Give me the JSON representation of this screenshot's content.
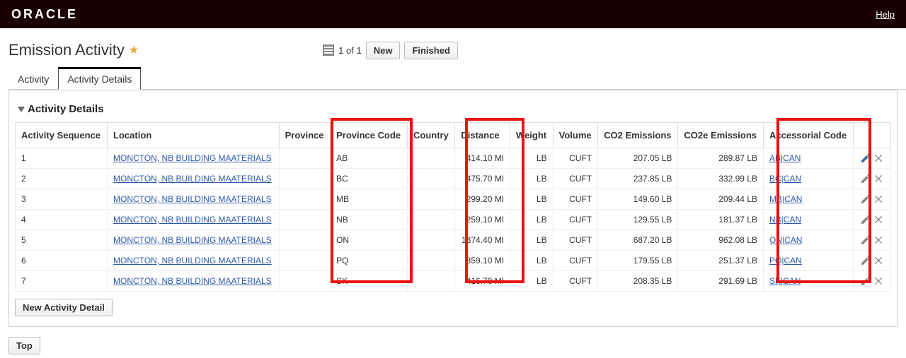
{
  "topbar": {
    "brand": "ORACLE",
    "help": "Help"
  },
  "header": {
    "title": "Emission Activity",
    "counter": "1 of 1",
    "btn_new": "New",
    "btn_finished": "Finished"
  },
  "tabs": {
    "activity": "Activity",
    "activity_details": "Activity Details"
  },
  "section": {
    "title": "Activity Details"
  },
  "columns": {
    "seq": "Activity Sequence",
    "location": "Location",
    "province": "Province",
    "province_code": "Province Code",
    "country": "Country",
    "distance": "Distance",
    "weight": "Weight",
    "volume": "Volume",
    "co2": "CO2 Emissions",
    "co2e": "CO2e Emissions",
    "acc_code": "Accessorial Code"
  },
  "rows": [
    {
      "seq": "1",
      "location": "MONCTON, NB BUILDING MAATERIALS",
      "province": "",
      "province_code": "AB",
      "country": "",
      "distance": "414.10 MI",
      "weight": "LB",
      "volume": "CUFT",
      "co2": "207.05 LB",
      "co2e": "289.87 LB",
      "acc": "AB|CAN"
    },
    {
      "seq": "2",
      "location": "MONCTON, NB BUILDING MAATERIALS",
      "province": "",
      "province_code": "BC",
      "country": "",
      "distance": "475.70 MI",
      "weight": "LB",
      "volume": "CUFT",
      "co2": "237.85 LB",
      "co2e": "332.99 LB",
      "acc": "BC|CAN"
    },
    {
      "seq": "3",
      "location": "MONCTON, NB BUILDING MAATERIALS",
      "province": "",
      "province_code": "MB",
      "country": "",
      "distance": "299.20 MI",
      "weight": "LB",
      "volume": "CUFT",
      "co2": "149.60 LB",
      "co2e": "209.44 LB",
      "acc": "MB|CAN"
    },
    {
      "seq": "4",
      "location": "MONCTON, NB BUILDING MAATERIALS",
      "province": "",
      "province_code": "NB",
      "country": "",
      "distance": "259.10 MI",
      "weight": "LB",
      "volume": "CUFT",
      "co2": "129.55 LB",
      "co2e": "181.37 LB",
      "acc": "NB|CAN"
    },
    {
      "seq": "5",
      "location": "MONCTON, NB BUILDING MAATERIALS",
      "province": "",
      "province_code": "ON",
      "country": "",
      "distance": "1374.40 MI",
      "weight": "LB",
      "volume": "CUFT",
      "co2": "687.20 LB",
      "co2e": "962.08 LB",
      "acc": "ON|CAN"
    },
    {
      "seq": "6",
      "location": "MONCTON, NB BUILDING MAATERIALS",
      "province": "",
      "province_code": "PQ",
      "country": "",
      "distance": "359.10 MI",
      "weight": "LB",
      "volume": "CUFT",
      "co2": "179.55 LB",
      "co2e": "251.37 LB",
      "acc": "PQ|CAN"
    },
    {
      "seq": "7",
      "location": "MONCTON, NB BUILDING MAATERIALS",
      "province": "",
      "province_code": "SK",
      "country": "",
      "distance": "416.70 MI",
      "weight": "LB",
      "volume": "CUFT",
      "co2": "208.35 LB",
      "co2e": "291.69 LB",
      "acc": "SK|CAN"
    }
  ],
  "buttons": {
    "new_activity_detail": "New Activity Detail",
    "top": "Top"
  }
}
